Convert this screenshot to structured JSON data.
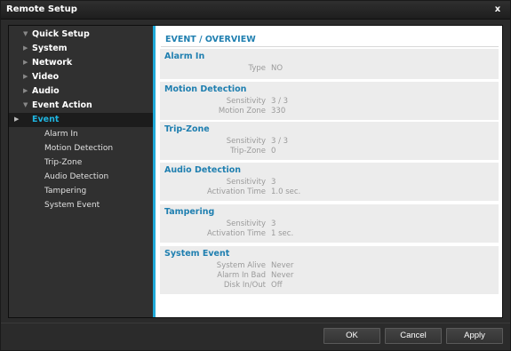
{
  "window": {
    "title": "Remote Setup",
    "close_label": "x"
  },
  "sidebar": {
    "items": [
      {
        "label": "Quick Setup",
        "expanded": true
      },
      {
        "label": "System",
        "expanded": false
      },
      {
        "label": "Network",
        "expanded": false
      },
      {
        "label": "Video",
        "expanded": false
      },
      {
        "label": "Audio",
        "expanded": false
      },
      {
        "label": "Event Action",
        "expanded": true
      },
      {
        "label": "Event",
        "expanded": true,
        "selected": true
      }
    ],
    "event_children": [
      "Alarm In",
      "Motion Detection",
      "Trip-Zone",
      "Audio Detection",
      "Tampering",
      "System Event"
    ]
  },
  "main": {
    "heading": "EVENT / OVERVIEW",
    "sections": [
      {
        "title": "Alarm In",
        "rows": [
          {
            "key": "Type",
            "value": "NO"
          }
        ]
      },
      {
        "title": "Motion Detection",
        "rows": [
          {
            "key": "Sensitivity",
            "value": "3 / 3"
          },
          {
            "key": "Motion Zone",
            "value": "330"
          }
        ]
      },
      {
        "title": "Trip-Zone",
        "rows": [
          {
            "key": "Sensitivity",
            "value": "3 / 3"
          },
          {
            "key": "Trip-Zone",
            "value": "0"
          }
        ]
      },
      {
        "title": "Audio Detection",
        "rows": [
          {
            "key": "Sensitivity",
            "value": "3"
          },
          {
            "key": "Activation Time",
            "value": "1.0 sec."
          }
        ]
      },
      {
        "title": "Tampering",
        "rows": [
          {
            "key": "Sensitivity",
            "value": "3"
          },
          {
            "key": "Activation Time",
            "value": "1 sec."
          }
        ]
      },
      {
        "title": "System Event",
        "rows": [
          {
            "key": "System Alive",
            "value": "Never"
          },
          {
            "key": "Alarm In Bad",
            "value": "Never"
          },
          {
            "key": "Disk In/Out",
            "value": "Off"
          }
        ]
      }
    ]
  },
  "buttons": {
    "ok": "OK",
    "cancel": "Cancel",
    "apply": "Apply"
  },
  "colors": {
    "accent": "#1fa9d8",
    "section_title": "#1f7fb0",
    "selected_item": "#1fb5e0"
  }
}
